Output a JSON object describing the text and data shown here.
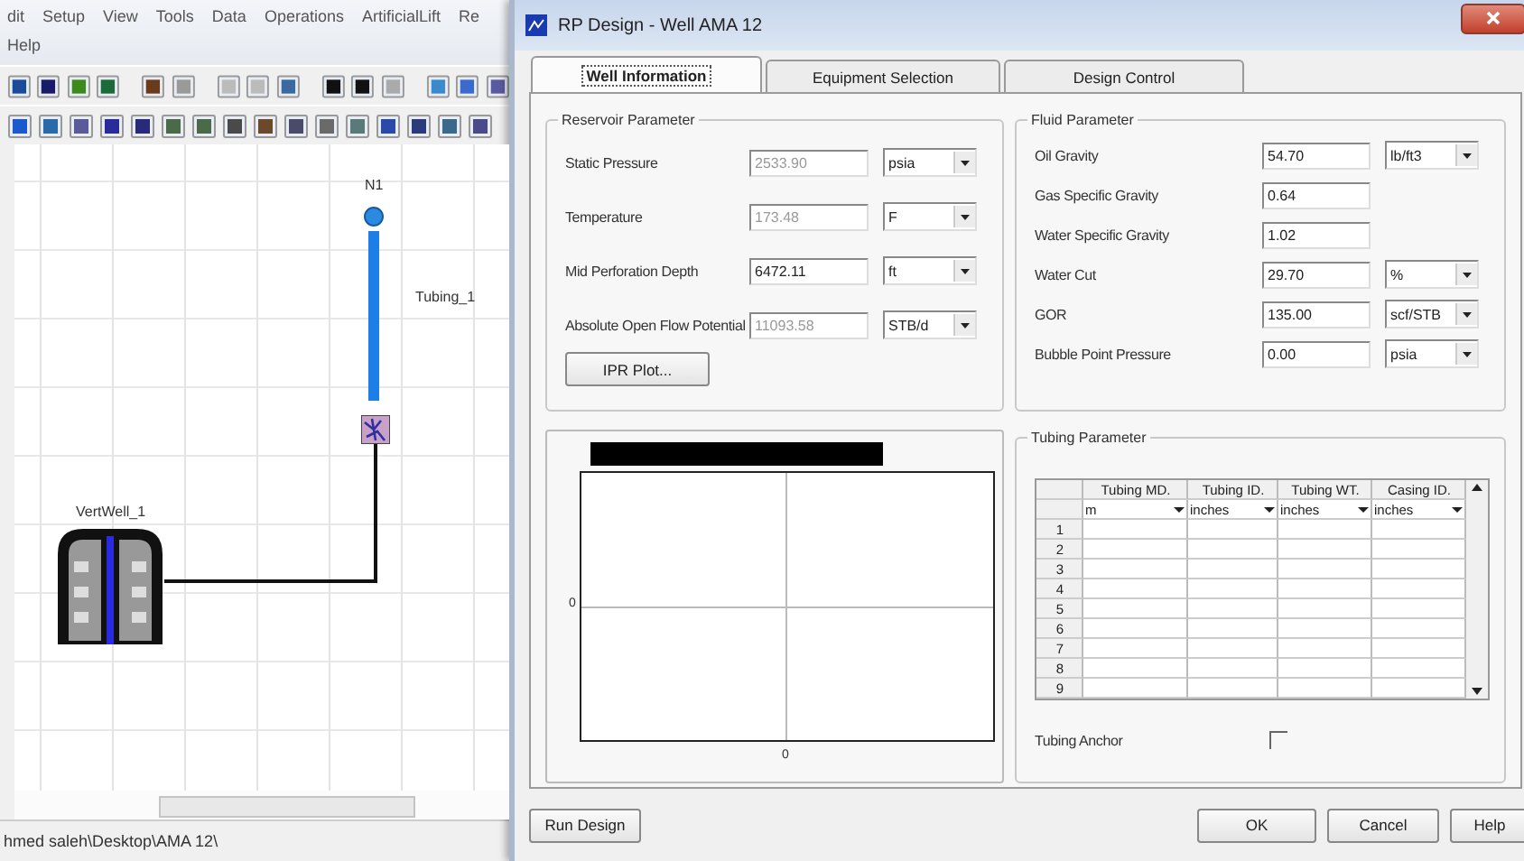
{
  "app": {
    "menu": [
      "dit",
      "Setup",
      "View",
      "Tools",
      "Data",
      "Operations",
      "ArtificialLift",
      "Re"
    ],
    "menu_row2": [
      "Help"
    ],
    "canvas": {
      "nodes": [
        {
          "kind": "node",
          "label": "N1"
        },
        {
          "kind": "tubing",
          "label": "Tubing_1"
        },
        {
          "kind": "well",
          "label": "VertWell_1"
        }
      ]
    },
    "status_bar": "hmed saleh\\Desktop\\AMA 12\\"
  },
  "dialog": {
    "title": "RP Design - Well AMA 12",
    "tabs": [
      {
        "label": "Well Information",
        "selected": true
      },
      {
        "label": "Equipment Selection",
        "selected": false
      },
      {
        "label": "Design Control",
        "selected": false
      }
    ],
    "reservoir": {
      "title": "Reservoir Parameter",
      "button": "IPR Plot...",
      "fields": [
        {
          "label": "Static Pressure",
          "value": "2533.90",
          "unit": "psia",
          "disabled": true
        },
        {
          "label": "Temperature",
          "value": "173.48",
          "unit": "F",
          "disabled": true
        },
        {
          "label": "Mid Perforation Depth",
          "value": "6472.11",
          "unit": "ft",
          "disabled": false
        },
        {
          "label": "Absolute Open Flow Potential",
          "value": "11093.58",
          "unit": "STB/d",
          "disabled": true
        }
      ]
    },
    "fluid": {
      "title": "Fluid Parameter",
      "fields": [
        {
          "label": "Oil Gravity",
          "value": "54.70",
          "unit": "lb/ft3",
          "disabled": false
        },
        {
          "label": "Gas Specific Gravity",
          "value": "0.64",
          "disabled": false
        },
        {
          "label": "Water Specific Gravity",
          "value": "1.02",
          "disabled": false
        },
        {
          "label": "Water Cut",
          "value": "29.70",
          "unit": "%",
          "disabled": false
        },
        {
          "label": "GOR",
          "value": "135.00",
          "unit": "scf/STB",
          "disabled": false
        },
        {
          "label": "Bubble Point Pressure",
          "value": "0.00",
          "unit": "psia",
          "disabled": false
        }
      ]
    },
    "plot": {
      "y_tick": "0",
      "x_tick": "0"
    },
    "tubing": {
      "title": "Tubing Parameter",
      "columns": [
        {
          "header": "Tubing MD.",
          "unit": "m"
        },
        {
          "header": "Tubing ID.",
          "unit": "inches"
        },
        {
          "header": "Tubing WT.",
          "unit": "inches"
        },
        {
          "header": "Casing ID.",
          "unit": "inches"
        }
      ],
      "row_numbers": [
        "1",
        "2",
        "3",
        "4",
        "5",
        "6",
        "7",
        "8",
        "9"
      ],
      "anchor": {
        "label": "Tubing Anchor",
        "checked": false
      }
    },
    "buttons": {
      "run": "Run Design",
      "ok": "OK",
      "cancel": "Cancel",
      "help": "Help"
    }
  }
}
